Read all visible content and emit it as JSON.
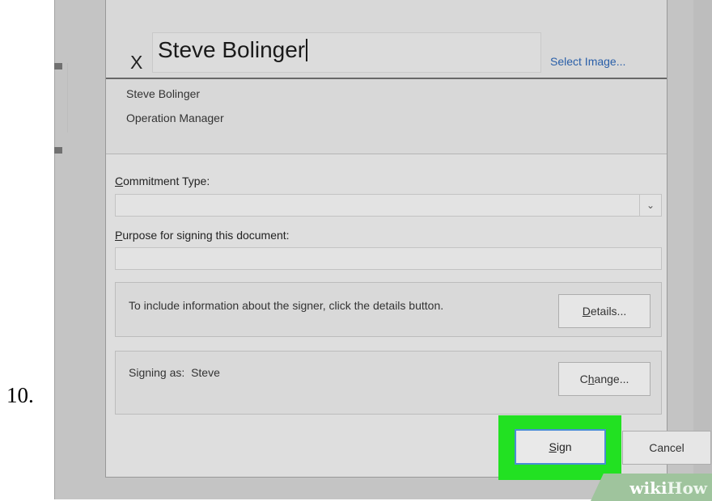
{
  "step": {
    "number": "10."
  },
  "signature": {
    "x_mark": "X",
    "typed_name": "Steve Bolinger",
    "select_image_link": "Select Image...",
    "signer_name": "Steve Bolinger",
    "signer_title": "Operation Manager"
  },
  "commitment": {
    "label_accel": "C",
    "label_rest": "ommitment Type:",
    "selected_value": "",
    "dropdown_glyph": "⌄"
  },
  "purpose": {
    "label_accel": "P",
    "label_rest": "urpose for signing this document:",
    "value": ""
  },
  "details": {
    "text": "To include information about the signer, click the details button.",
    "button_accel": "D",
    "button_rest": "etails..."
  },
  "signing_as": {
    "label": "Signing as:",
    "value": "Steve",
    "button_pre": "C",
    "button_accel": "h",
    "button_rest": "ange..."
  },
  "actions": {
    "sign_accel": "S",
    "sign_rest": "ign",
    "cancel_label": "Cancel",
    "highlight_color": "#22e122"
  },
  "watermark": {
    "wiki": "wiki",
    "how": "How"
  }
}
